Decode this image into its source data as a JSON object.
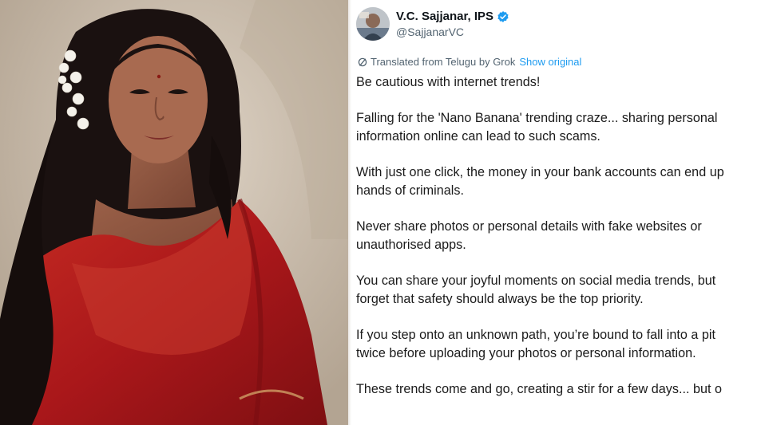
{
  "tweet": {
    "display_name": "V.C. Sajjanar, IPS",
    "handle": "@SajjanarVC",
    "translated_prefix": "Translated from Telugu by Grok",
    "show_original_label": "Show original",
    "paragraphs": [
      [
        "Be cautious with internet trends!"
      ],
      [
        "Falling for the 'Nano Banana' trending craze... sharing personal",
        "information online can lead to such scams."
      ],
      [
        "With just one click, the money in your bank accounts can end up",
        "hands of criminals."
      ],
      [
        "Never share photos or personal details with fake websites or",
        "unauthorised apps."
      ],
      [
        "You can share your joyful moments on social media trends, but",
        "forget that safety should always be the top priority."
      ],
      [
        "If you step onto an unknown path, you’re bound to fall into a pit",
        "twice before uploading your photos or personal information."
      ],
      [
        "These trends come and go, creating a stir for a few days... but o"
      ]
    ]
  },
  "colors": {
    "saree_red": "#b01a1a",
    "link_blue": "#1d9bf0",
    "verified_blue": "#1d9bf0",
    "muted_gray": "#536471"
  },
  "icons": {
    "verified": "verified-badge-icon",
    "translate": "grok-icon"
  }
}
